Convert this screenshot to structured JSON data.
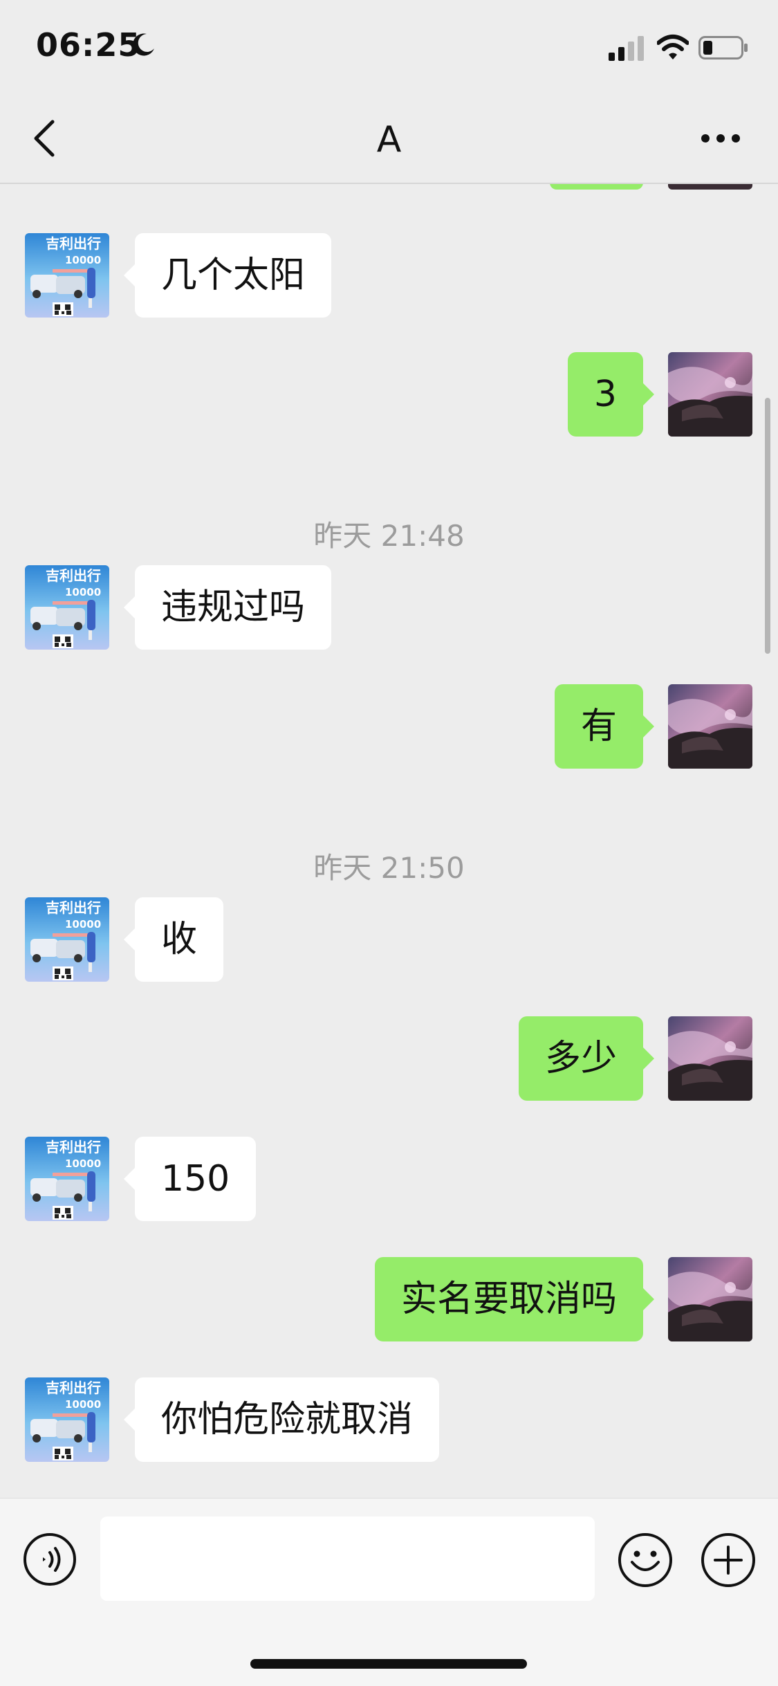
{
  "status_bar": {
    "time": "06:25"
  },
  "header": {
    "title": "A"
  },
  "messages": [
    {
      "side": "left",
      "text": "几个太阳"
    },
    {
      "side": "right",
      "text": "3"
    },
    {
      "side": "time",
      "text": "昨天 21:48"
    },
    {
      "side": "left",
      "text": "违规过吗"
    },
    {
      "side": "right",
      "text": "有"
    },
    {
      "side": "time",
      "text": "昨天 21:50"
    },
    {
      "side": "left",
      "text": "收"
    },
    {
      "side": "right",
      "text": "多少"
    },
    {
      "side": "left",
      "text": "150"
    },
    {
      "side": "right",
      "text": "实名要取消吗"
    },
    {
      "side": "left",
      "text": "你怕危险就取消"
    }
  ],
  "avatar_left": {
    "brand_text": "吉利出行",
    "number_text": "10000"
  },
  "input": {
    "value": ""
  },
  "colors": {
    "sent_bubble": "#95ec69",
    "received_bubble": "#ffffff",
    "background": "#ededed"
  }
}
